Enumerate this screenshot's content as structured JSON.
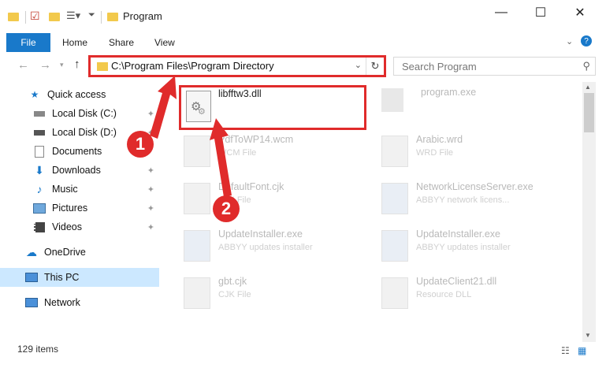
{
  "window": {
    "title": "Program",
    "minimize": "—",
    "maximize": "☐",
    "close": "✕"
  },
  "ribbon": {
    "file": "File",
    "tabs": [
      "Home",
      "Share",
      "View"
    ]
  },
  "address": {
    "path": "C:\\Program Files\\Program Directory"
  },
  "search": {
    "placeholder": "Search Program"
  },
  "nav": {
    "items": [
      {
        "label": "Quick access",
        "icon": "star-icon"
      },
      {
        "label": "Local Disk (C:)",
        "icon": "drive-icon"
      },
      {
        "label": "Local Disk (D:)",
        "icon": "drive-icon"
      },
      {
        "label": "Documents",
        "icon": "documents-icon"
      },
      {
        "label": "Downloads",
        "icon": "download-icon"
      },
      {
        "label": "Music",
        "icon": "music-icon"
      },
      {
        "label": "Pictures",
        "icon": "pictures-icon"
      },
      {
        "label": "Videos",
        "icon": "videos-icon"
      },
      {
        "label": "OneDrive",
        "icon": "cloud-icon"
      },
      {
        "label": "This PC",
        "icon": "computer-icon"
      },
      {
        "label": "Network",
        "icon": "network-icon"
      }
    ]
  },
  "files": {
    "highlighted": {
      "name": "libfftw3.dll"
    },
    "items": [
      {
        "name": "program.exe",
        "type": ""
      },
      {
        "name": "PdfToWP14.wcm",
        "type": "WCM File"
      },
      {
        "name": "Arabic.wrd",
        "type": "WRD File"
      },
      {
        "name": "DefaultFont.cjk",
        "type": "CJK File"
      },
      {
        "name": "NetworkLicenseServer.exe",
        "type": "ABBYY network licens..."
      },
      {
        "name": "UpdateInstaller.exe",
        "type": "ABBYY updates installer"
      },
      {
        "name": "UpdateInstaller.exe",
        "type": "ABBYY updates installer"
      },
      {
        "name": "gbt.cjk",
        "type": "CJK File"
      },
      {
        "name": "UpdateClient21.dll",
        "type": "Resource DLL"
      }
    ]
  },
  "status": {
    "count": "129 items"
  },
  "annotations": {
    "step1": "1",
    "step2": "2"
  },
  "colors": {
    "accent": "#1979ca",
    "highlight": "#e02b2b",
    "selection": "#cce8ff"
  }
}
